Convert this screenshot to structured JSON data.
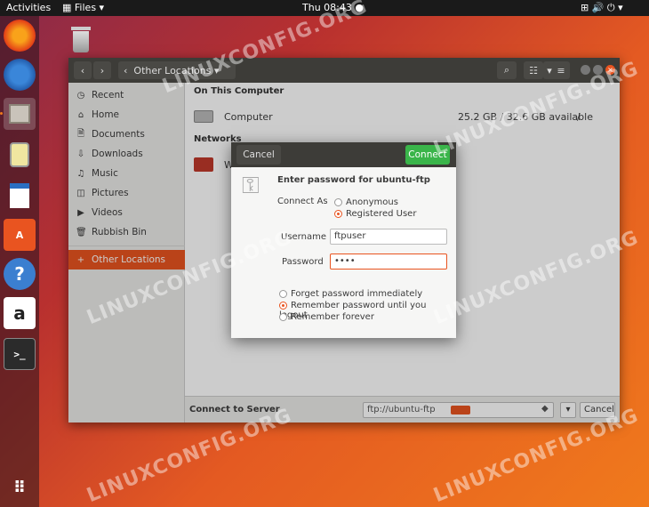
{
  "topbar": {
    "activities": "Activities",
    "app_menu": "Files ▾",
    "clock": "Thu 08:43 ●",
    "status_icons": "⊞  🔊  ⏻ ▾"
  },
  "files": {
    "path_label": "Other Locations",
    "sidebar": [
      {
        "label": "Recent",
        "icon": "◷"
      },
      {
        "label": "Home",
        "icon": "⌂"
      },
      {
        "label": "Documents",
        "icon": "🗎"
      },
      {
        "label": "Downloads",
        "icon": "⇩"
      },
      {
        "label": "Music",
        "icon": "♫"
      },
      {
        "label": "Pictures",
        "icon": "◫"
      },
      {
        "label": "Videos",
        "icon": "▶"
      },
      {
        "label": "Rubbish Bin",
        "icon": "🗑"
      },
      {
        "label": "Other Locations",
        "icon": "+"
      }
    ],
    "on_this_computer": "On This Computer",
    "computer_label": "Computer",
    "computer_size": "25.2 GB / 32.6 GB available",
    "computer_path": "/",
    "networks": "Networks",
    "network_item": "W",
    "connect_to_server": "Connect to Server",
    "server_value": "ftp://ubuntu-ftp",
    "bottom_cancel": "Cancel"
  },
  "dialog": {
    "cancel": "Cancel",
    "connect": "Connect",
    "title": "Enter password for ubuntu-ftp",
    "connect_as": "Connect As",
    "anonymous": "Anonymous",
    "registered": "Registered User",
    "username_label": "Username",
    "username_value": "ftpuser",
    "password_label": "Password",
    "password_value": "••••",
    "forget": "Forget password immediately",
    "remember_logout": "Remember password until you logout",
    "remember_forever": "Remember forever"
  },
  "watermark": "LINUXCONFIG.ORG",
  "colors": {
    "accent": "#e95420",
    "connect_green": "#3ab54a"
  }
}
